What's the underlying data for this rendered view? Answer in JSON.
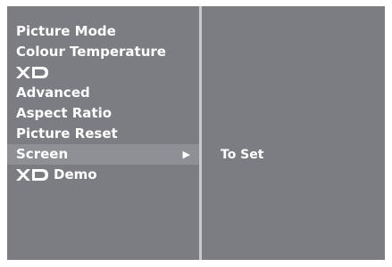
{
  "menu": {
    "items": [
      {
        "label": "Picture Mode"
      },
      {
        "label": "Colour Temperature"
      },
      {
        "label": "",
        "logo": "xd-logo"
      },
      {
        "label": "Advanced"
      },
      {
        "label": "Aspect Ratio"
      },
      {
        "label": "Picture Reset"
      },
      {
        "label": "Screen",
        "selected": true,
        "arrow": "▶"
      },
      {
        "label": "Demo",
        "logo": "xd-logo"
      }
    ]
  },
  "submenu": {
    "value": "To Set"
  },
  "colors": {
    "panel": "#7c7d82",
    "highlight": "#8f9095",
    "divider": "#c9cacd",
    "text": "#ffffff"
  }
}
